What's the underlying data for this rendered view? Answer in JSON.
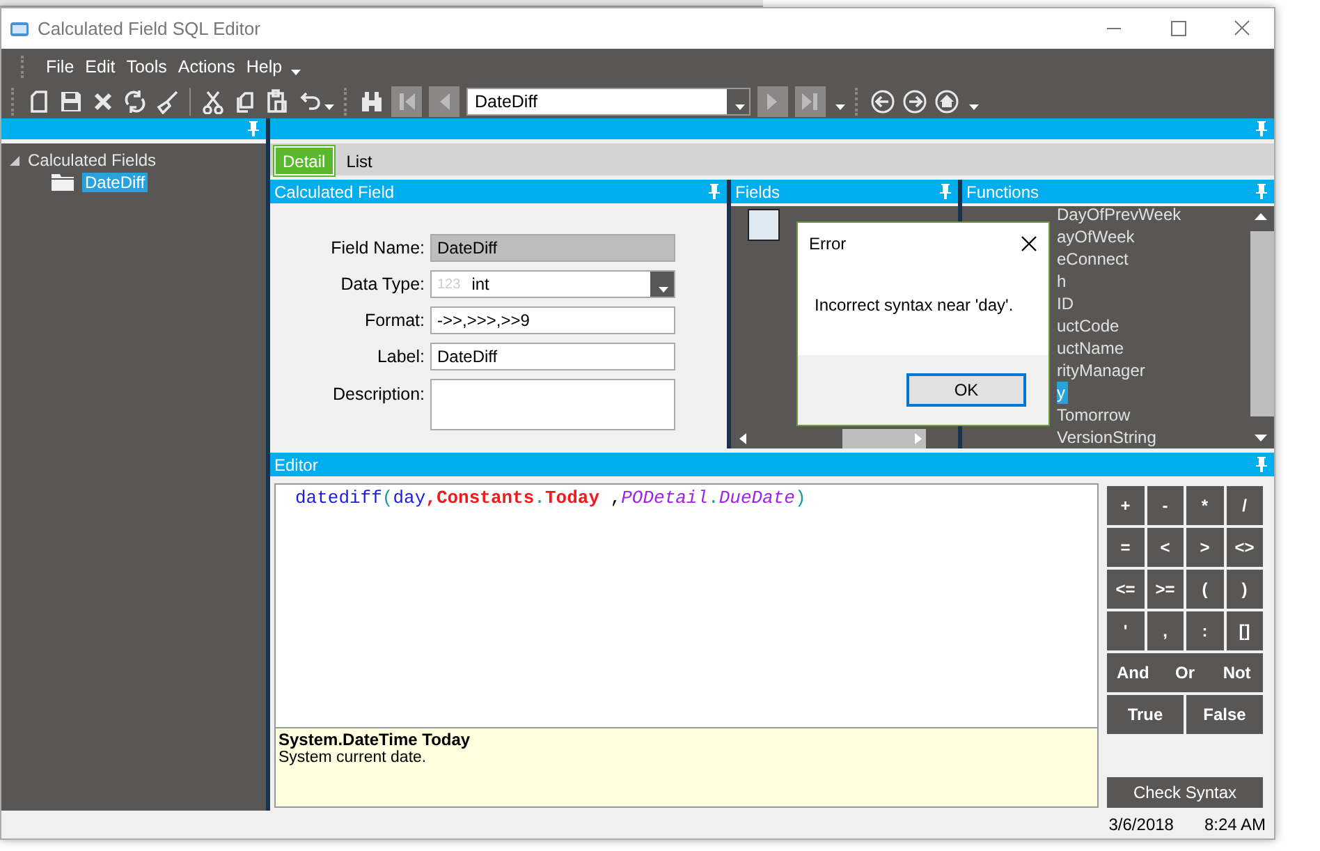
{
  "window": {
    "title": "Calculated Field SQL Editor"
  },
  "menu": [
    "File",
    "Edit",
    "Tools",
    "Actions",
    "Help"
  ],
  "toolbar": {
    "record_combo": {
      "value": "DateDiff"
    }
  },
  "tree": {
    "items": [
      {
        "label": "Calculated Fields",
        "expanded": true,
        "children": [
          {
            "label": "DateDiff",
            "selected": true
          }
        ]
      }
    ]
  },
  "tabs": [
    {
      "label": "Detail",
      "selected": true
    },
    {
      "label": "List",
      "selected": false
    }
  ],
  "calculated_field": {
    "title": "Calculated Field",
    "fields": [
      {
        "label": "Field Name:",
        "kind": "readonly",
        "value": "DateDiff"
      },
      {
        "label": "Data Type:",
        "kind": "dropdown",
        "prefix": "123",
        "value": "int"
      },
      {
        "label": "Format:",
        "kind": "text",
        "value": "->>,>>>,>>9"
      },
      {
        "label": "Label:",
        "kind": "text",
        "value": "DateDiff"
      },
      {
        "label": "Description:",
        "kind": "textarea"
      }
    ]
  },
  "fields_panel": {
    "title": "Fields"
  },
  "functions_panel": {
    "title": "Functions",
    "items": [
      {
        "label": "DayOfPrevWeek",
        "selected": false
      },
      {
        "label": "ayOfWeek",
        "selected": false
      },
      {
        "label": "eConnect",
        "selected": false
      },
      {
        "label": "h",
        "selected": false
      },
      {
        "label": "ID",
        "selected": false
      },
      {
        "label": "uctCode",
        "selected": false
      },
      {
        "label": "uctName",
        "selected": false
      },
      {
        "label": "rityManager",
        "selected": false
      },
      {
        "label": "y",
        "selected": true
      },
      {
        "label": "Tomorrow",
        "selected": false
      },
      {
        "label": "VersionString",
        "selected": false
      }
    ]
  },
  "editor": {
    "title": "Editor",
    "code": [
      {
        "text": "datediff",
        "kind": "function"
      },
      {
        "text": "(",
        "kind": "punct"
      },
      {
        "text": "day",
        "kind": "function"
      },
      {
        "text": ",",
        "kind": "constant"
      },
      {
        "text": "Constants",
        "kind": "constant"
      },
      {
        "text": ".",
        "kind": "punct"
      },
      {
        "text": "Today",
        "kind": "constant"
      },
      {
        "text": " ,",
        "kind": "plain"
      },
      {
        "text": "PODetail",
        "kind": "field"
      },
      {
        "text": ".",
        "kind": "punct"
      },
      {
        "text": "DueDate",
        "kind": "field"
      },
      {
        "text": ")",
        "kind": "punct"
      }
    ],
    "help": {
      "signature": "System.DateTime Today",
      "description": "System current date."
    },
    "keypad": [
      [
        "+",
        "-",
        "*",
        "/"
      ],
      [
        "=",
        "<",
        ">",
        "<>"
      ],
      [
        "<=",
        ">=",
        "(",
        ")"
      ],
      [
        "'",
        ",",
        ":",
        "[]"
      ],
      [
        "And",
        "Or",
        "Not"
      ],
      [
        "True",
        "False"
      ]
    ],
    "check_button": "Check Syntax"
  },
  "dialog": {
    "title": "Error",
    "message": "Incorrect syntax near 'day'.",
    "button": "OK"
  },
  "status_bar": {
    "date": "3/6/2018",
    "time": "8:24 AM"
  }
}
